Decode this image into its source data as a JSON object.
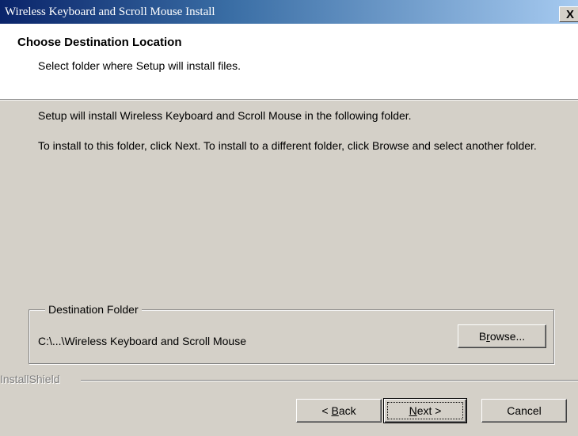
{
  "window": {
    "title": "Wireless Keyboard and Scroll Mouse Install",
    "close_label": "X"
  },
  "header": {
    "heading": "Choose Destination Location",
    "subheading": "Select folder where Setup will install files."
  },
  "body": {
    "paragraph1": "Setup will install Wireless Keyboard and Scroll Mouse in the following folder.",
    "paragraph2": "To install to this folder, click Next. To install to a different folder, click Browse and select another folder."
  },
  "destination": {
    "group_label": "Destination Folder",
    "path": "C:\\...\\Wireless Keyboard and Scroll Mouse",
    "browse_pre": "B",
    "browse_ul": "r",
    "browse_post": "owse..."
  },
  "footer": {
    "brand": "InstallShield",
    "back_pre": "< ",
    "back_ul": "B",
    "back_post": "ack",
    "next_ul": "N",
    "next_post": "ext >",
    "cancel_label": "Cancel"
  },
  "colors": {
    "dialog_bg": "#d4d0c8",
    "title_start": "#0a246a",
    "title_end": "#a6caf0"
  },
  "icons": {
    "close": "close-icon"
  }
}
